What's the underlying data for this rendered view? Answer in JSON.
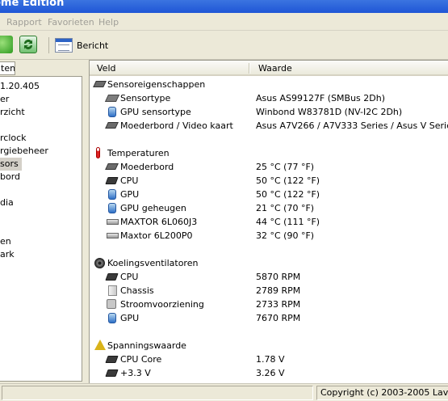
{
  "window": {
    "title": "ome Edition"
  },
  "menu": {
    "items": [
      "Rapport",
      "Favorieten",
      "Help"
    ]
  },
  "toolbar": {
    "report_label": "Bericht"
  },
  "left_panel": {
    "tab_label": "ten",
    "items": [
      "1.20.405",
      "er",
      "rzicht",
      "",
      "rclock",
      "rgiebeheer",
      "sors",
      "bord",
      "",
      "dia",
      "",
      "",
      "en",
      "ark"
    ],
    "selected_index": 6
  },
  "columns": {
    "field": "Veld",
    "value": "Waarde"
  },
  "sections": [
    {
      "title": "Sensoreigenschappen",
      "icon": "sensor-board-icon",
      "rows": [
        {
          "label": "Sensortype",
          "value": "Asus AS99127F  (SMBus 2Dh)",
          "icon": "sensor-chip-icon"
        },
        {
          "label": "GPU sensortype",
          "value": "Winbond W83781D  (NV-I2C 2Dh)",
          "icon": "gpu-icon"
        },
        {
          "label": "Moederbord / Video kaart",
          "value": "Asus A7V266 / A7V333 Series / Asus V Series",
          "icon": "motherboard-icon"
        }
      ]
    },
    {
      "title": "Temperaturen",
      "icon": "thermometer-icon",
      "rows": [
        {
          "label": "Moederbord",
          "value": "25 °C  (77 °F)",
          "icon": "motherboard-icon"
        },
        {
          "label": "CPU",
          "value": "50 °C  (122 °F)",
          "icon": "cpu-icon"
        },
        {
          "label": "GPU",
          "value": "50 °C  (122 °F)",
          "icon": "gpu-icon"
        },
        {
          "label": "GPU geheugen",
          "value": "21 °C  (70 °F)",
          "icon": "gpu-icon"
        },
        {
          "label": "MAXTOR 6L060J3",
          "value": "44 °C  (111 °F)",
          "icon": "hard-drive-icon"
        },
        {
          "label": "Maxtor 6L200P0",
          "value": "32 °C  (90 °F)",
          "icon": "hard-drive-icon"
        }
      ]
    },
    {
      "title": "Koelingsventilatoren",
      "icon": "fan-icon",
      "rows": [
        {
          "label": "CPU",
          "value": "5870 RPM",
          "icon": "cpu-icon"
        },
        {
          "label": "Chassis",
          "value": "2789 RPM",
          "icon": "chassis-icon"
        },
        {
          "label": "Stroomvoorziening",
          "value": "2733 RPM",
          "icon": "power-supply-icon"
        },
        {
          "label": "GPU",
          "value": "7670 RPM",
          "icon": "gpu-icon"
        }
      ]
    },
    {
      "title": "Spanningswaarde",
      "icon": "voltage-icon",
      "rows": [
        {
          "label": "CPU Core",
          "value": "1.78 V",
          "icon": "cpu-icon"
        },
        {
          "label": "+3.3 V",
          "value": "3.26 V",
          "icon": "cpu-icon"
        }
      ]
    }
  ],
  "status": {
    "copyright": "Copyright (c) 2003-2005 Lavalys"
  }
}
